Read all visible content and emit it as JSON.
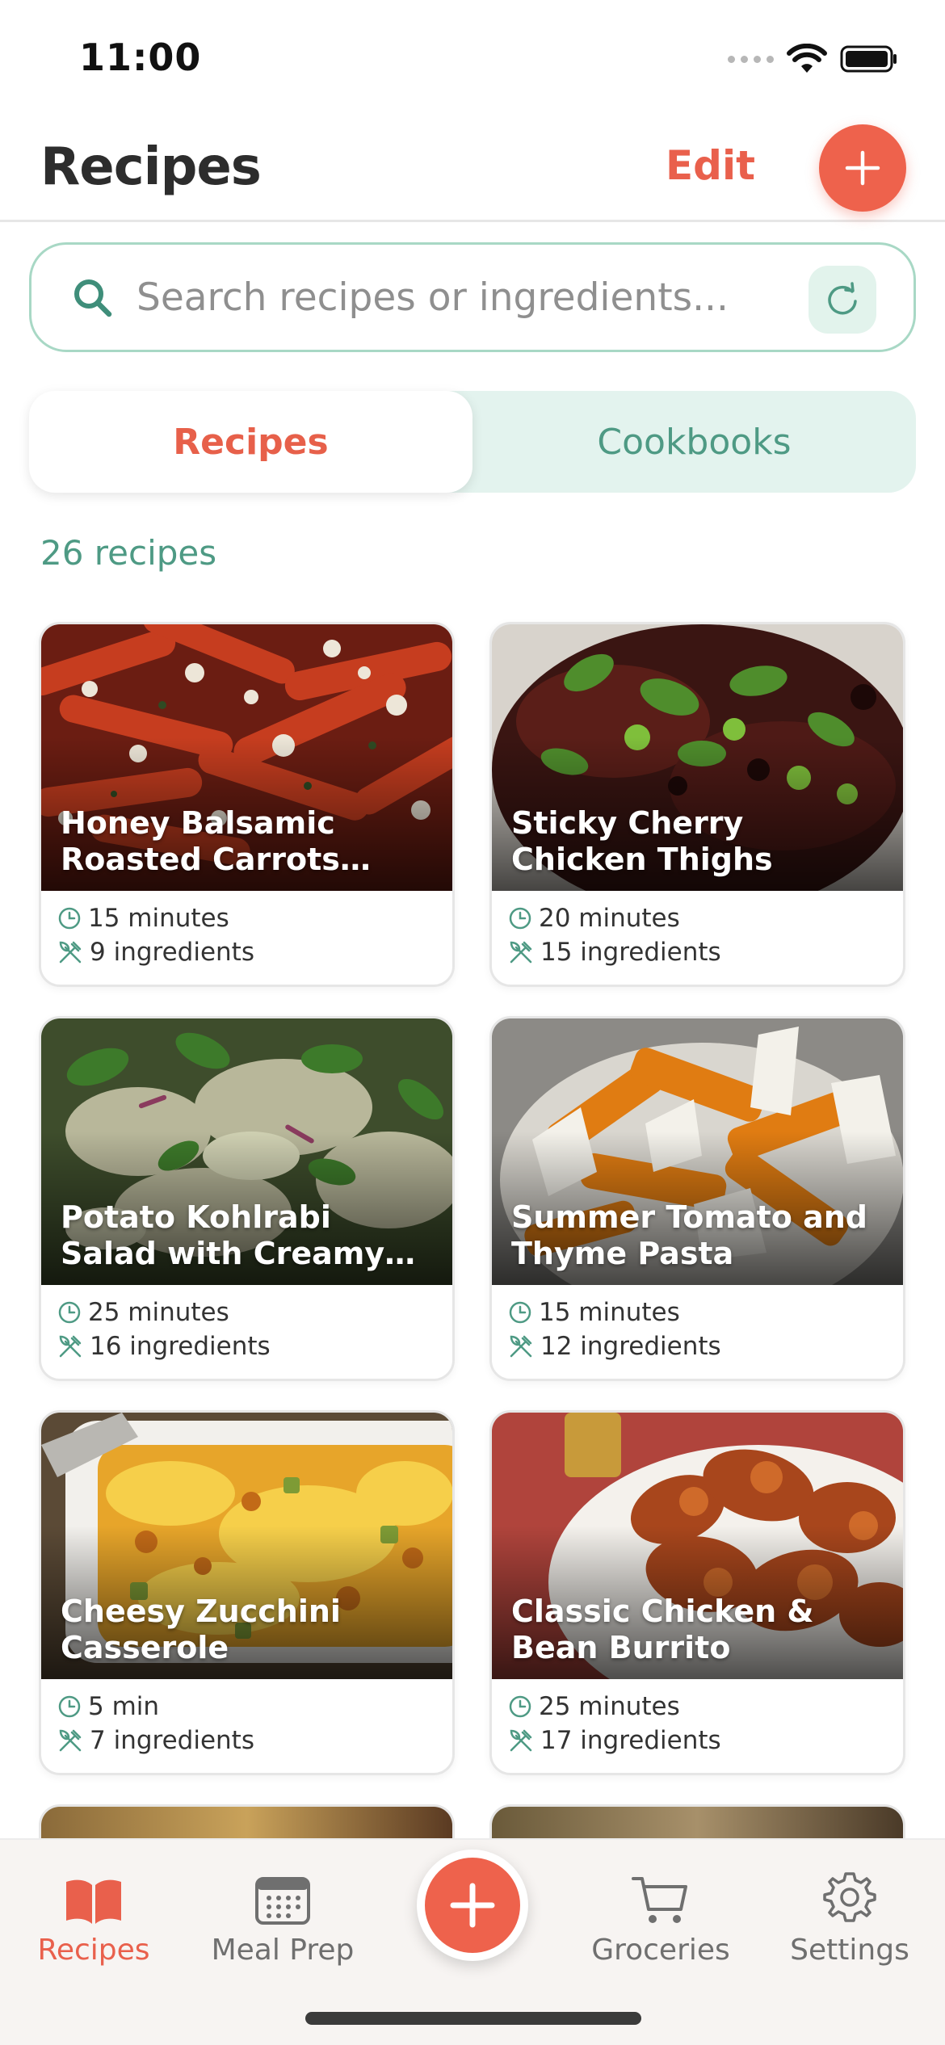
{
  "status": {
    "time": "11:00"
  },
  "header": {
    "title": "Recipes",
    "edit_label": "Edit"
  },
  "search": {
    "placeholder": "Search recipes or ingredients..."
  },
  "segments": {
    "recipes": "Recipes",
    "cookbooks": "Cookbooks",
    "selected": "Recipes"
  },
  "summary": {
    "count_label": "26 recipes"
  },
  "recipes": [
    {
      "title": "Honey Balsamic Roasted Carrots with...",
      "time": "15 minutes",
      "ingredients": "9 ingredients"
    },
    {
      "title": "Sticky Cherry Chicken Thighs",
      "time": "20 minutes",
      "ingredients": "15 ingredients"
    },
    {
      "title": "Potato Kohlrabi Salad with Creamy Tahini-...",
      "time": "25 minutes",
      "ingredients": "16 ingredients"
    },
    {
      "title": "Summer Tomato and Thyme Pasta",
      "time": "15 minutes",
      "ingredients": "12 ingredients"
    },
    {
      "title": "Cheesy Zucchini Casserole",
      "time": "5 min",
      "ingredients": "7 ingredients"
    },
    {
      "title": "Classic Chicken & Bean Burrito",
      "time": "25 minutes",
      "ingredients": "17 ingredients"
    }
  ],
  "tabs": {
    "recipes": "Recipes",
    "meal_prep": "Meal Prep",
    "groceries": "Groceries",
    "settings": "Settings",
    "active": "Recipes"
  },
  "colors": {
    "accent": "#ee624c",
    "teal": "#4e9a84",
    "search_border": "#a8d8c5",
    "segment_bg": "#e3f3ee",
    "tab_bar_bg": "#f7f4f2"
  },
  "icons": {
    "add": "plus-icon",
    "search": "search-icon",
    "refresh": "refresh-icon",
    "time": "clock-icon",
    "ingredients": "utensils-icon",
    "tab_recipes": "book-icon",
    "tab_meal_prep": "calendar-icon",
    "tab_groceries": "cart-icon",
    "tab_settings": "gear-icon"
  }
}
